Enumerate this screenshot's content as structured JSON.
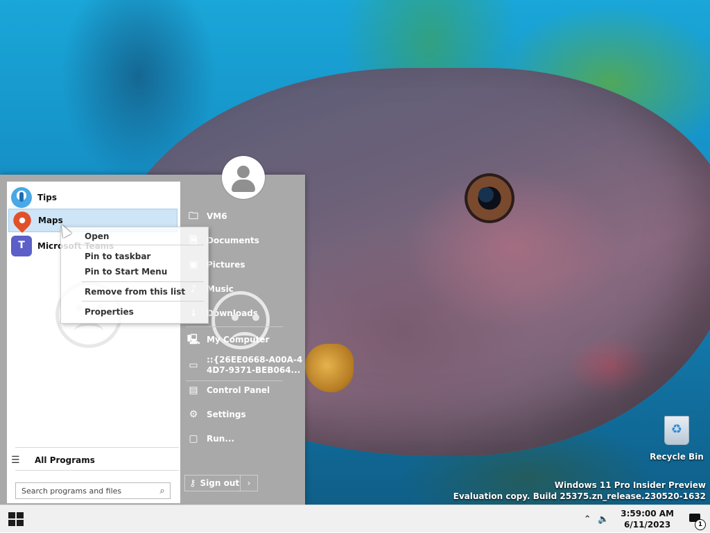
{
  "start_menu": {
    "pinned": [
      {
        "label": "Tips",
        "icon": "tips-icon"
      },
      {
        "label": "Maps",
        "icon": "maps-icon"
      },
      {
        "label": "Microsoft Teams",
        "icon": "teams-icon"
      }
    ],
    "all_programs": "All Programs",
    "search_placeholder": "Search programs and files",
    "right_items": [
      {
        "label": "VM6",
        "icon": "folder-user-icon"
      },
      {
        "label": "Documents",
        "icon": "document-icon"
      },
      {
        "label": "Pictures",
        "icon": "pictures-icon"
      },
      {
        "label": "Music",
        "icon": "music-icon"
      },
      {
        "label": "Downloads",
        "icon": "downloads-icon"
      },
      {
        "label": "My Computer",
        "icon": "computer-icon"
      },
      {
        "label_line1": "::{26EE0668-A00A-4",
        "label_line2": "4D7-9371-BEB064...",
        "icon": "desktop-icon"
      },
      {
        "label": "Control Panel",
        "icon": "control-panel-icon"
      },
      {
        "label": "Settings",
        "icon": "settings-icon"
      },
      {
        "label": "Run...",
        "icon": "run-icon"
      }
    ],
    "sign_out": "Sign out"
  },
  "context_menu": {
    "items": [
      "Open",
      "Pin to taskbar",
      "Pin to Start Menu",
      "Remove from this list",
      "Properties"
    ]
  },
  "desktop": {
    "recycle_bin": "Recycle Bin",
    "watermark_line1": "Windows 11 Pro Insider Preview",
    "watermark_line2": "Evaluation copy. Build 25375.zn_release.230520-1632"
  },
  "taskbar": {
    "time": "3:59:00 AM",
    "date": "6/11/2023",
    "notification_count": "1"
  }
}
